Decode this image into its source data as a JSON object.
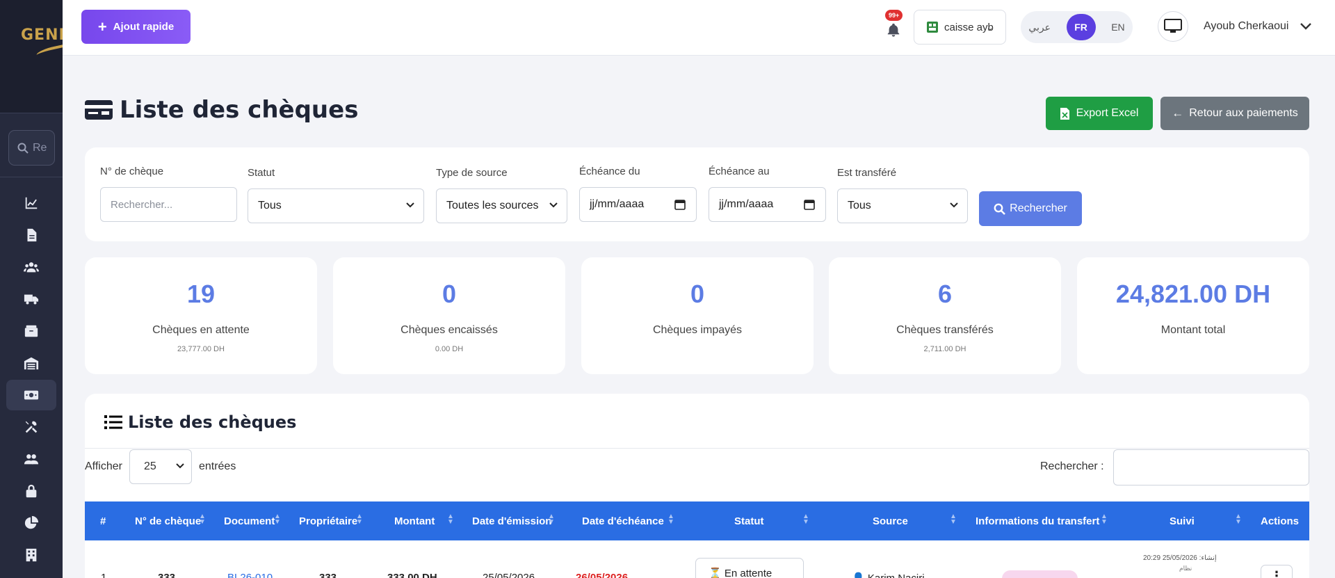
{
  "sidebar": {
    "logo_text": "GENIS",
    "search_placeholder": "Re",
    "nav_icons": [
      "chart-line-icon",
      "file-icon",
      "users-icon",
      "truck-icon",
      "box-icon",
      "warehouse-icon",
      "money-bill-icon",
      "tools-icon",
      "user-group-icon",
      "lock-icon",
      "chart-pie-icon",
      "building-icon",
      "trash-icon"
    ],
    "active_index": 6
  },
  "header": {
    "quick_add_label": "Ajout rapide",
    "notif_badge": "99+",
    "caisse_label": "caisse ayb",
    "lang": {
      "ar": "عربي",
      "fr": "FR",
      "en": "EN",
      "active": "FR"
    },
    "user_name": "Ayoub Cherkaoui"
  },
  "page": {
    "title": "Liste des chèques",
    "export_label": "Export Excel",
    "back_label": "Retour aux paiements"
  },
  "filters": {
    "cheque_no_label": "N° de chèque",
    "cheque_no_placeholder": "Rechercher...",
    "statut_label": "Statut",
    "statut_value": "Tous",
    "source_type_label": "Type de source",
    "source_type_value": "Toutes les sources",
    "due_from_label": "Échéance du",
    "due_from_value": "jj/mm/aaaa",
    "due_to_label": "Échéance au",
    "due_to_value": "jj/mm/aaaa",
    "transferred_label": "Est transféré",
    "transferred_value": "Tous",
    "search_button": "Rechercher"
  },
  "stats": [
    {
      "value": "19",
      "label": "Chèques en attente",
      "sub": "23,777.00 DH"
    },
    {
      "value": "0",
      "label": "Chèques encaissés",
      "sub": "0.00 DH"
    },
    {
      "value": "0",
      "label": "Chèques impayés",
      "sub": ""
    },
    {
      "value": "6",
      "label": "Chèques transférés",
      "sub": "2,711.00 DH"
    },
    {
      "value": "24,821.00 DH",
      "label": "Montant total",
      "sub": ""
    }
  ],
  "table": {
    "title": "Liste des chèques",
    "show_label": "Afficher",
    "show_value": "25",
    "entries_label": "entrées",
    "search_label": "Rechercher :",
    "columns": [
      "#",
      "N° de chèque",
      "Document",
      "Propriétaire",
      "Montant",
      "Date d'émission",
      "Date d'échéance",
      "Statut",
      "Source",
      "Informations du transfert",
      "Suivi",
      "Actions"
    ],
    "rows": [
      {
        "index": "1",
        "cheque_no": "333",
        "document": "BL26-010",
        "owner": "333",
        "amount": "333.00 DH",
        "issue_date": "25/05/2026",
        "due_date": "26/05/2026",
        "status": "En attente",
        "source": "Karim Naciri",
        "tracking_line1": "إنشاء: 25/05/2026 20:29",
        "tracking_line2": "نظام"
      }
    ]
  },
  "colors": {
    "sidebar_bg": "#262a3d",
    "accent_purple": "#7747ec",
    "stat_blue": "#5c7ce4",
    "table_header": "#2a6de3",
    "export_green": "#1f9e44",
    "back_gray": "#6c757d"
  }
}
